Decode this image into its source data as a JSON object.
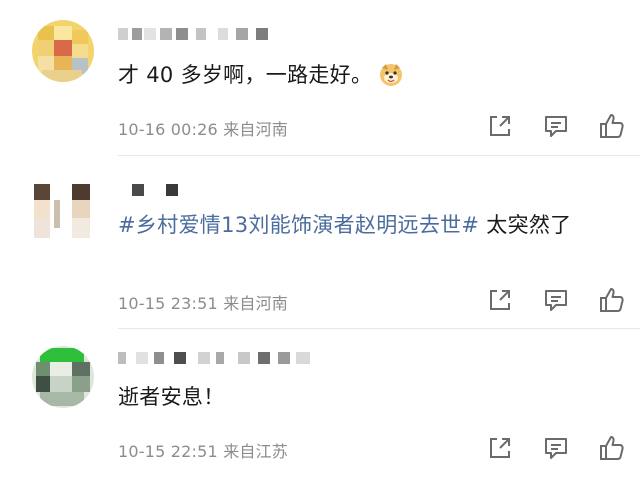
{
  "comments": [
    {
      "text": "才 40 多岁啊，一路走好。",
      "emoji": "dog-emoji",
      "time": "10-16 00:26",
      "location": "来自河南"
    },
    {
      "hashtag": "#乡村爱情13刘能饰演者赵明远去世#",
      "text": " 太突然了",
      "time": "10-15 23:51",
      "location": "来自河南"
    },
    {
      "text": "逝者安息！",
      "time": "10-15 22:51",
      "location": "来自江苏"
    }
  ],
  "icons": {
    "share": "share-icon",
    "comment": "comment-icon",
    "like": "like-icon"
  },
  "colors": {
    "hashtag": "#4b6c9e",
    "meta": "#8c8c8c",
    "icon": "#6b6b6b"
  }
}
